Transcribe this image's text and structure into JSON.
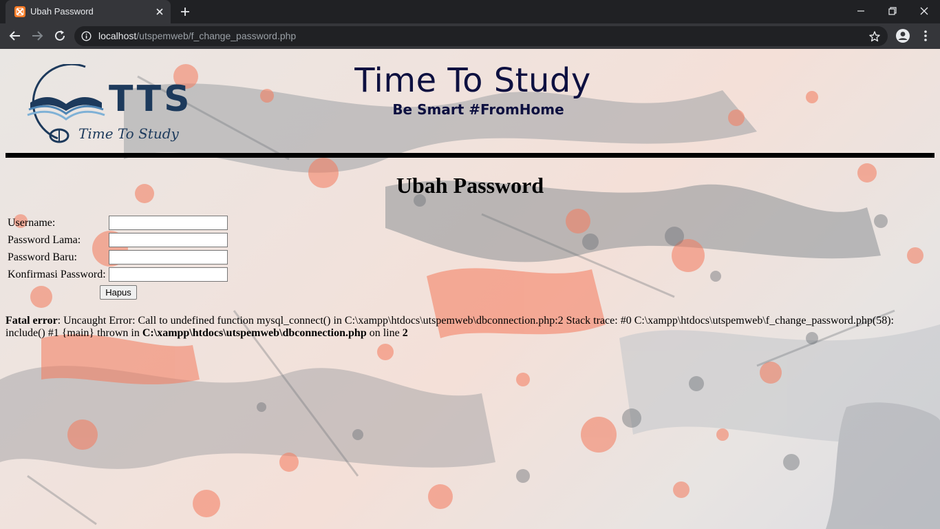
{
  "browser": {
    "tab_title": "Ubah Password",
    "url_host": "localhost",
    "url_path": "/utspemweb/f_change_password.php"
  },
  "header": {
    "logo_text": "TTS",
    "logo_script": "Time To Study",
    "title": "Time To Study",
    "tagline": "Be Smart #FromHome"
  },
  "main": {
    "heading": "Ubah Password",
    "form": {
      "username_label": "Username:",
      "old_password_label": "Password Lama:",
      "new_password_label": "Password Baru:",
      "confirm_password_label": "Konfirmasi Password:",
      "username_value": "",
      "old_password_value": "",
      "new_password_value": "",
      "confirm_password_value": "",
      "reset_label": "Hapus"
    },
    "error": {
      "label": "Fatal error",
      "message": ": Uncaught Error: Call to undefined function mysql_connect() in C:\\xampp\\htdocs\\utspemweb\\dbconnection.php:2 Stack trace: #0 C:\\xampp\\htdocs\\utspemweb\\f_change_password.php(58): include() #1 {main} thrown in ",
      "file": "C:\\xampp\\htdocs\\utspemweb\\dbconnection.php",
      "on_line_text": " on line ",
      "line": "2"
    }
  },
  "colors": {
    "title_navy": "#0d1040",
    "logo_navy": "#1d3a5c",
    "splash_orange": "#f47a5c",
    "splash_gray": "#6d7278"
  }
}
